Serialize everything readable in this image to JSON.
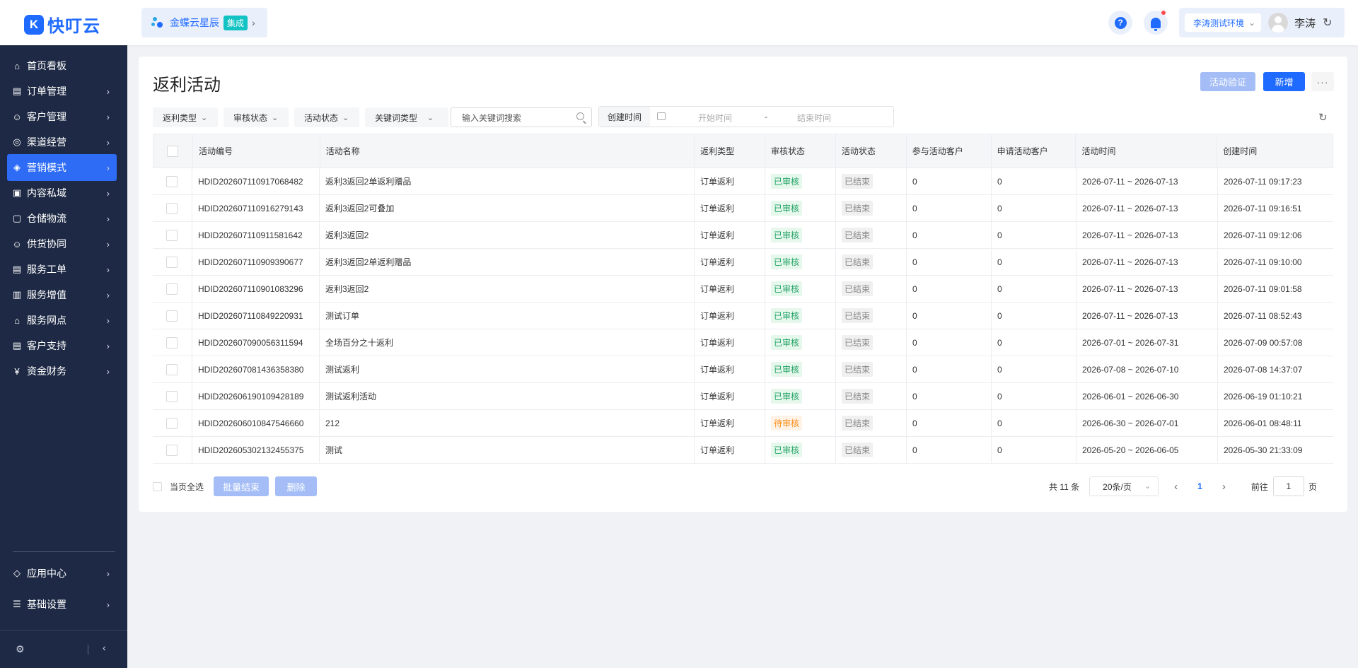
{
  "brand": {
    "logo_glyph": "K",
    "name": "快叮云",
    "color": "#1f6bff"
  },
  "integration": {
    "name": "金蝶云星辰",
    "tag": "集成"
  },
  "header": {
    "help_glyph": "?",
    "environment": "李涛测试环境",
    "user": "李涛"
  },
  "sidebar": {
    "items": [
      {
        "label": "首页看板",
        "icon": "home-icon",
        "glyph": "⌂",
        "has_chevron": false,
        "active": false
      },
      {
        "label": "订单管理",
        "icon": "order-icon",
        "glyph": "▤",
        "has_chevron": true,
        "active": false
      },
      {
        "label": "客户管理",
        "icon": "user-icon",
        "glyph": "☺",
        "has_chevron": true,
        "active": false
      },
      {
        "label": "渠道经营",
        "icon": "channel-icon",
        "glyph": "◎",
        "has_chevron": true,
        "active": false
      },
      {
        "label": "营销模式",
        "icon": "tag-icon",
        "glyph": "◈",
        "has_chevron": true,
        "active": true
      },
      {
        "label": "内容私域",
        "icon": "image-icon",
        "glyph": "▣",
        "has_chevron": true,
        "active": false
      },
      {
        "label": "仓储物流",
        "icon": "warehouse-icon",
        "glyph": "▢",
        "has_chevron": true,
        "active": false
      },
      {
        "label": "供货协同",
        "icon": "supply-icon",
        "glyph": "☺",
        "has_chevron": true,
        "active": false
      },
      {
        "label": "服务工单",
        "icon": "ticket-icon",
        "glyph": "▤",
        "has_chevron": true,
        "active": false
      },
      {
        "label": "服务增值",
        "icon": "bag-icon",
        "glyph": "▥",
        "has_chevron": true,
        "active": false
      },
      {
        "label": "服务网点",
        "icon": "store-icon",
        "glyph": "⌂",
        "has_chevron": true,
        "active": false
      },
      {
        "label": "客户支持",
        "icon": "support-icon",
        "glyph": "▤",
        "has_chevron": true,
        "active": false
      },
      {
        "label": "资金财务",
        "icon": "finance-icon",
        "glyph": "¥",
        "has_chevron": true,
        "active": false
      }
    ],
    "bottom_items": [
      {
        "label": "应用中心",
        "icon": "app-center-icon",
        "glyph": "◇"
      },
      {
        "label": "基础设置",
        "icon": "settings-list-icon",
        "glyph": "☰"
      }
    ]
  },
  "page": {
    "title": "返利活动",
    "verify_button": "活动验证",
    "new_button": "新增",
    "more_button": "···"
  },
  "filters": {
    "rebate_type": "返利类型",
    "review_status": "审核状态",
    "activity_status": "活动状态",
    "keyword_type": "关键词类型",
    "search_placeholder": "输入关键词搜索",
    "created_label": "创建时间",
    "start_placeholder": "开始时间",
    "separator": "-",
    "end_placeholder": "结束时间"
  },
  "table": {
    "columns": [
      "活动编号",
      "活动名称",
      "返利类型",
      "审核状态",
      "活动状态",
      "参与活动客户",
      "申请活动客户",
      "活动时间",
      "创建时间"
    ],
    "rows": [
      {
        "id": "HDID202607110917068482",
        "name": "返利3返回2单返利赠品",
        "type": "订单返利",
        "review": "已审核",
        "review_kind": "ok",
        "status": "已结束",
        "joined": "0",
        "applied": "0",
        "period": "2026-07-11 ~ 2026-07-13",
        "created": "2026-07-11 09:17:23"
      },
      {
        "id": "HDID202607110916279143",
        "name": "返利3返回2可叠加",
        "type": "订单返利",
        "review": "已审核",
        "review_kind": "ok",
        "status": "已结束",
        "joined": "0",
        "applied": "0",
        "period": "2026-07-11 ~ 2026-07-13",
        "created": "2026-07-11 09:16:51"
      },
      {
        "id": "HDID202607110911581642",
        "name": "返利3返回2",
        "type": "订单返利",
        "review": "已审核",
        "review_kind": "ok",
        "status": "已结束",
        "joined": "0",
        "applied": "0",
        "period": "2026-07-11 ~ 2026-07-13",
        "created": "2026-07-11 09:12:06"
      },
      {
        "id": "HDID202607110909390677",
        "name": "返利3返回2单返利赠品",
        "type": "订单返利",
        "review": "已审核",
        "review_kind": "ok",
        "status": "已结束",
        "joined": "0",
        "applied": "0",
        "period": "2026-07-11 ~ 2026-07-13",
        "created": "2026-07-11 09:10:00"
      },
      {
        "id": "HDID202607110901083296",
        "name": "返利3返回2",
        "type": "订单返利",
        "review": "已审核",
        "review_kind": "ok",
        "status": "已结束",
        "joined": "0",
        "applied": "0",
        "period": "2026-07-11 ~ 2026-07-13",
        "created": "2026-07-11 09:01:58"
      },
      {
        "id": "HDID202607110849220931",
        "name": "测试订单",
        "type": "订单返利",
        "review": "已审核",
        "review_kind": "ok",
        "status": "已结束",
        "joined": "0",
        "applied": "0",
        "period": "2026-07-11 ~ 2026-07-13",
        "created": "2026-07-11 08:52:43"
      },
      {
        "id": "HDID202607090056311594",
        "name": "全场百分之十返利",
        "type": "订单返利",
        "review": "已审核",
        "review_kind": "ok",
        "status": "已结束",
        "joined": "0",
        "applied": "0",
        "period": "2026-07-01 ~ 2026-07-31",
        "created": "2026-07-09 00:57:08"
      },
      {
        "id": "HDID202607081436358380",
        "name": "测试返利",
        "type": "订单返利",
        "review": "已审核",
        "review_kind": "ok",
        "status": "已结束",
        "joined": "0",
        "applied": "0",
        "period": "2026-07-08 ~ 2026-07-10",
        "created": "2026-07-08 14:37:07"
      },
      {
        "id": "HDID202606190109428189",
        "name": "测试返利活动",
        "type": "订单返利",
        "review": "已审核",
        "review_kind": "ok",
        "status": "已结束",
        "joined": "0",
        "applied": "0",
        "period": "2026-06-01 ~ 2026-06-30",
        "created": "2026-06-19 01:10:21"
      },
      {
        "id": "HDID202606010847546660",
        "name": "212",
        "type": "订单返利",
        "review": "待审核",
        "review_kind": "pending",
        "status": "已结束",
        "joined": "0",
        "applied": "0",
        "period": "2026-06-30 ~ 2026-07-01",
        "created": "2026-06-01 08:48:11"
      },
      {
        "id": "HDID202605302132455375",
        "name": "测试",
        "type": "订单返利",
        "review": "已审核",
        "review_kind": "ok",
        "status": "已结束",
        "joined": "0",
        "applied": "0",
        "period": "2026-05-20 ~ 2026-06-05",
        "created": "2026-05-30 21:33:09"
      }
    ]
  },
  "bulk": {
    "select_page": "当页全选",
    "batch_end": "批量结束",
    "delete": "删除"
  },
  "pagination": {
    "total": "共 11 条",
    "page_size": "20条/页",
    "current": "1",
    "goto_label": "前往",
    "goto_value": "1",
    "goto_unit": "页"
  }
}
